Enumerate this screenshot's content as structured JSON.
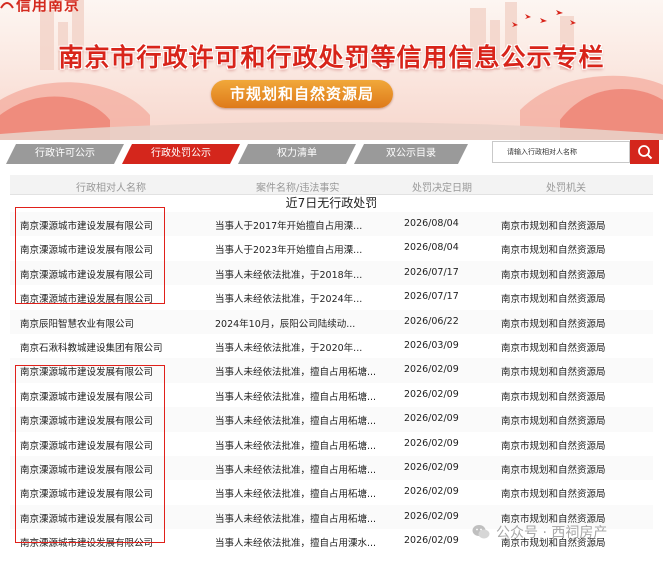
{
  "header": {
    "logo_text": "信用南京",
    "title": "南京市行政许可和行政处罚等信用信息公示专栏",
    "subtitle": "市规划和自然资源局",
    "colors": {
      "brand_red": "#d8241a",
      "pill_orange": "#e88a25",
      "tab_gray": "#9a9a9a"
    }
  },
  "tabs": [
    {
      "label": "行政许可公示",
      "active": false
    },
    {
      "label": "行政处罚公示",
      "active": true
    },
    {
      "label": "权力清单",
      "active": false
    },
    {
      "label": "双公示目录",
      "active": false
    }
  ],
  "search": {
    "placeholder": "请输入行政相对人名称",
    "icon": "search-icon"
  },
  "table": {
    "headers": [
      "行政相对人名称",
      "案件名称/违法事实",
      "处罚决定日期",
      "处罚机关"
    ],
    "no_record_notice": "近7日无行政处罚",
    "rows": [
      {
        "name": "南京溧源城市建设发展有限公司",
        "case": "当事人于2017年开始擅自占用溧...",
        "date": "2026/08/04",
        "org": "南京市规划和自然资源局"
      },
      {
        "name": "南京溧源城市建设发展有限公司",
        "case": "当事人于2023年开始擅自占用溧...",
        "date": "2026/08/04",
        "org": "南京市规划和自然资源局"
      },
      {
        "name": "南京溧源城市建设发展有限公司",
        "case": "当事人未经依法批准，于2018年...",
        "date": "2026/07/17",
        "org": "南京市规划和自然资源局"
      },
      {
        "name": "南京溧源城市建设发展有限公司",
        "case": "当事人未经依法批准，于2024年...",
        "date": "2026/07/17",
        "org": "南京市规划和自然资源局"
      },
      {
        "name": "南京辰阳智慧农业有限公司",
        "case": "2024年10月，辰阳公司陆续动...",
        "date": "2026/06/22",
        "org": "南京市规划和自然资源局"
      },
      {
        "name": "南京石湫科教城建设集团有限公司",
        "case": "当事人未经依法批准，于2020年...",
        "date": "2026/03/09",
        "org": "南京市规划和自然资源局"
      },
      {
        "name": "南京溧源城市建设发展有限公司",
        "case": "当事人未经依法批准，擅自占用柘塘...",
        "date": "2026/02/09",
        "org": "南京市规划和自然资源局"
      },
      {
        "name": "南京溧源城市建设发展有限公司",
        "case": "当事人未经依法批准，擅自占用柘塘...",
        "date": "2026/02/09",
        "org": "南京市规划和自然资源局"
      },
      {
        "name": "南京溧源城市建设发展有限公司",
        "case": "当事人未经依法批准，擅自占用柘塘...",
        "date": "2026/02/09",
        "org": "南京市规划和自然资源局"
      },
      {
        "name": "南京溧源城市建设发展有限公司",
        "case": "当事人未经依法批准，擅自占用柘塘...",
        "date": "2026/02/09",
        "org": "南京市规划和自然资源局"
      },
      {
        "name": "南京溧源城市建设发展有限公司",
        "case": "当事人未经依法批准，擅自占用柘塘...",
        "date": "2026/02/09",
        "org": "南京市规划和自然资源局"
      },
      {
        "name": "南京溧源城市建设发展有限公司",
        "case": "当事人未经依法批准，擅自占用柘塘...",
        "date": "2026/02/09",
        "org": "南京市规划和自然资源局"
      },
      {
        "name": "南京溧源城市建设发展有限公司",
        "case": "当事人未经依法批准，擅自占用柘塘...",
        "date": "2026/02/09",
        "org": "南京市规划和自然资源局"
      },
      {
        "name": "南京溧源城市建设发展有限公司",
        "case": "当事人未经依法批准，擅自占用溧水...",
        "date": "2026/02/09",
        "org": "南京市规划和自然资源局"
      }
    ]
  },
  "watermark": {
    "text": "公众号 · 西祠房产",
    "icon": "wechat-icon"
  }
}
